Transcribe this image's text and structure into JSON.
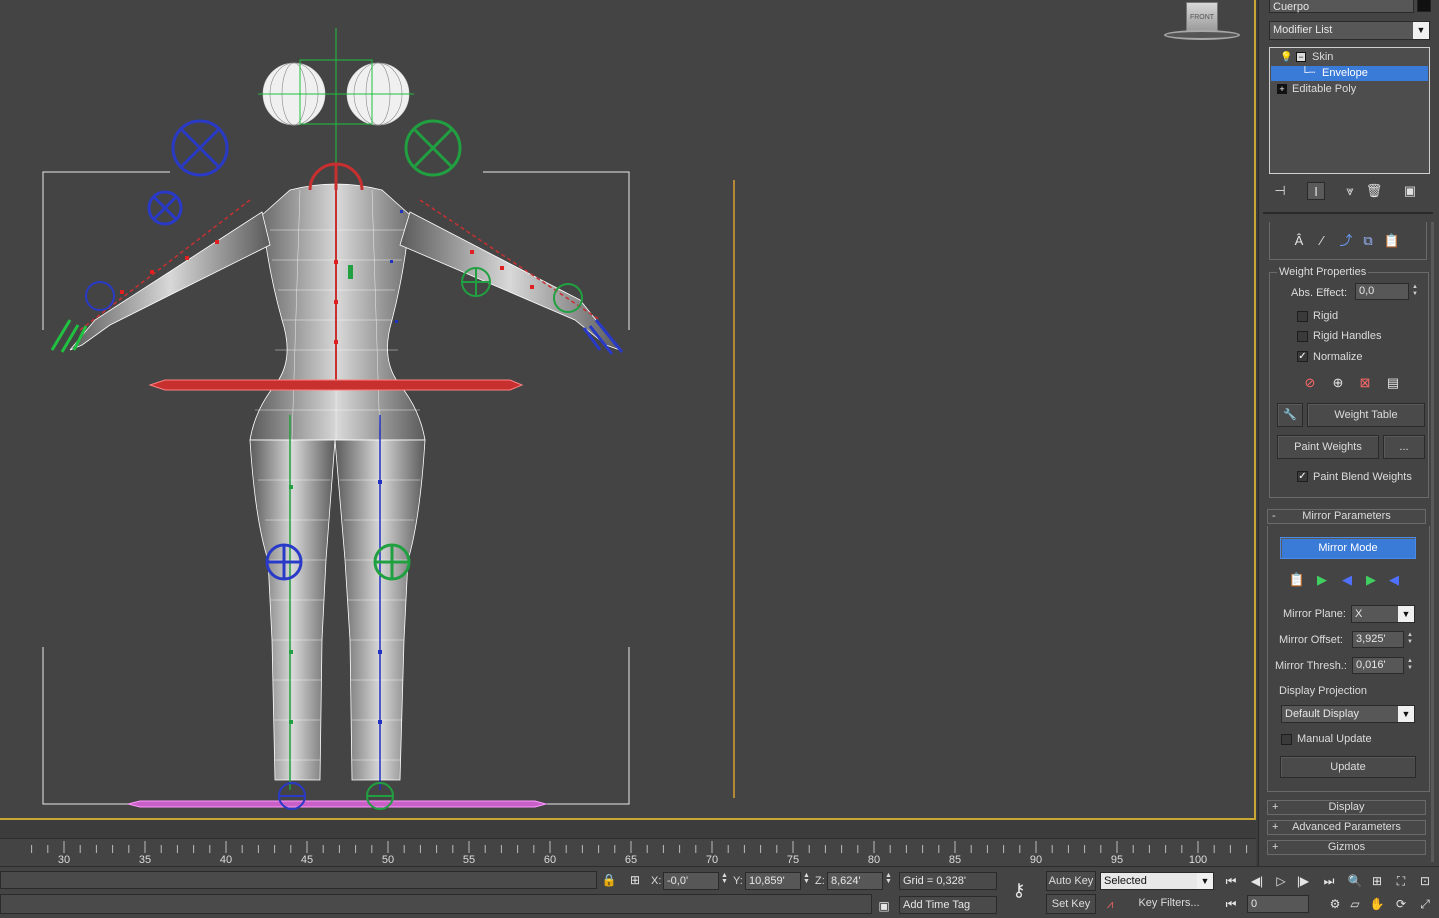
{
  "viewport": {
    "viewcube_label": "FRONT"
  },
  "command_panel": {
    "object_name": "Cuerpo",
    "modifier_list_label": "Modifier List",
    "stack": [
      {
        "label": "Skin",
        "selected": false
      },
      {
        "label": "Envelope",
        "selected": true
      },
      {
        "label": "Editable Poly",
        "selected": false
      }
    ],
    "weight_properties": {
      "title": "Weight Properties",
      "abs_effect_label": "Abs. Effect:",
      "abs_effect_value": "0,0",
      "rigid_label": "Rigid",
      "rigid_checked": false,
      "rigid_handles_label": "Rigid Handles",
      "rigid_handles_checked": false,
      "normalize_label": "Normalize",
      "normalize_checked": true,
      "weight_table_label": "Weight Table",
      "paint_weights_label": "Paint Weights",
      "paint_options_label": "...",
      "paint_blend_label": "Paint Blend Weights",
      "paint_blend_checked": true
    },
    "mirror_parameters": {
      "title": "Mirror Parameters",
      "mirror_mode_label": "Mirror Mode",
      "mirror_plane_label": "Mirror Plane:",
      "mirror_plane_value": "X",
      "mirror_offset_label": "Mirror Offset:",
      "mirror_offset_value": "3,925'",
      "mirror_thresh_label": "Mirror Thresh.:",
      "mirror_thresh_value": "0,016'",
      "display_projection_label": "Display Projection",
      "display_projection_value": "Default Display",
      "manual_update_label": "Manual Update",
      "manual_update_checked": false,
      "update_label": "Update"
    },
    "collapsed_rollouts": [
      {
        "label": "Display"
      },
      {
        "label": "Advanced Parameters"
      },
      {
        "label": "Gizmos"
      }
    ]
  },
  "timeline": {
    "ticks": [
      "30",
      "35",
      "40",
      "45",
      "50",
      "55",
      "60",
      "65",
      "70",
      "75",
      "80",
      "85",
      "90",
      "95",
      "100"
    ]
  },
  "status_bar": {
    "x_label": "X:",
    "x_value": "-0,0'",
    "y_label": "Y:",
    "y_value": "10,859'",
    "z_label": "Z:",
    "z_value": "8,624'",
    "grid_text": "Grid = 0,328'",
    "add_time_tag_label": "Add Time Tag",
    "auto_key_label": "Auto Key",
    "set_key_label": "Set Key",
    "selected_value": "Selected",
    "key_filters_label": "Key Filters...",
    "frame_value": "0"
  },
  "colors": {
    "accent_blue": "#3b7bd8",
    "viewport_border": "#c8a832",
    "bone_red": "#c83030",
    "bone_green": "#20a040",
    "bone_blue": "#2030c0"
  }
}
